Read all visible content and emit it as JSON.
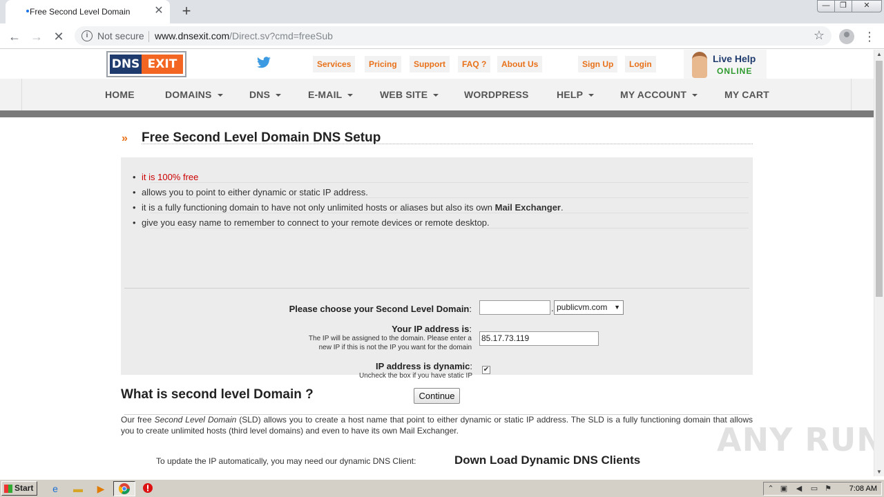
{
  "browser": {
    "tab_title": "Free Second Level Domain",
    "tab_close": "✕",
    "new_tab": "+",
    "security_label": "Not secure",
    "url_host": "www.dnsexit.com",
    "url_path": "/Direct.sv?cmd=freeSub",
    "window_controls": {
      "minimize": "—",
      "maximize": "❐",
      "close": "✕"
    }
  },
  "site": {
    "logo": {
      "part1": "DNS",
      "part2": "EXIT"
    },
    "top_links": [
      "Services",
      "Pricing",
      "Support",
      "FAQ ?",
      "About Us",
      "Sign Up",
      "Login"
    ],
    "live_help": {
      "line1": "Live Help",
      "line2": "ONLINE"
    },
    "nav": [
      "HOME",
      "DOMAINS",
      "DNS",
      "E-MAIL",
      "WEB SITE",
      "WORDPRESS",
      "HELP",
      "MY ACCOUNT",
      "MY CART"
    ]
  },
  "main": {
    "title": "Free Second Level Domain DNS Setup",
    "title_icon": "»",
    "bullets": [
      "it is 100% free",
      "allows you to point to either dynamic or static IP address.",
      "it is a fully functioning domain to have not only unlimited hosts or aliases but also its own ",
      "give you easy name to remember to connect to your remote devices or remote desktop."
    ],
    "bullet3_bold": "Mail Exchanger",
    "bullet3_end": ".",
    "form": {
      "sld_label": "Please choose your Second Level Domain",
      "colon": ":",
      "sld_value": "",
      "dot": ".",
      "domain_select": "publicvm.com",
      "ip_label": "Your IP address is",
      "ip_sub1": "The IP will be assigned to the domain. Please enter a",
      "ip_sub2": "new IP if this is not the IP you want for the domain",
      "ip_value": "85.17.73.119",
      "dynamic_label": "IP address is dynamic",
      "dynamic_sub": "Uncheck the box if you have static IP",
      "dynamic_checked": true,
      "continue_label": "Continue"
    },
    "section_title": "What is second level Domain ?",
    "para_start": "Our free ",
    "para_em": "Second Level Domain",
    "para_rest": " (SLD) allows you to create a host name that point to either dynamic or static IP address. The SLD is a fully functioning domain that allows you to create unlimited hosts (third level domains) and even to have its own Mail Exchanger.",
    "update_text": "To update the IP automatically, you may need our dynamic DNS Client:",
    "download_title": "Down Load Dynamic DNS Clients"
  },
  "watermark": "ANY RUN",
  "taskbar": {
    "start_label": "Start",
    "clock": "7:08 AM"
  },
  "colors": {
    "brand_orange": "#f26522",
    "brand_navy": "#1f3b6e",
    "link_orange": "#e8711a"
  }
}
